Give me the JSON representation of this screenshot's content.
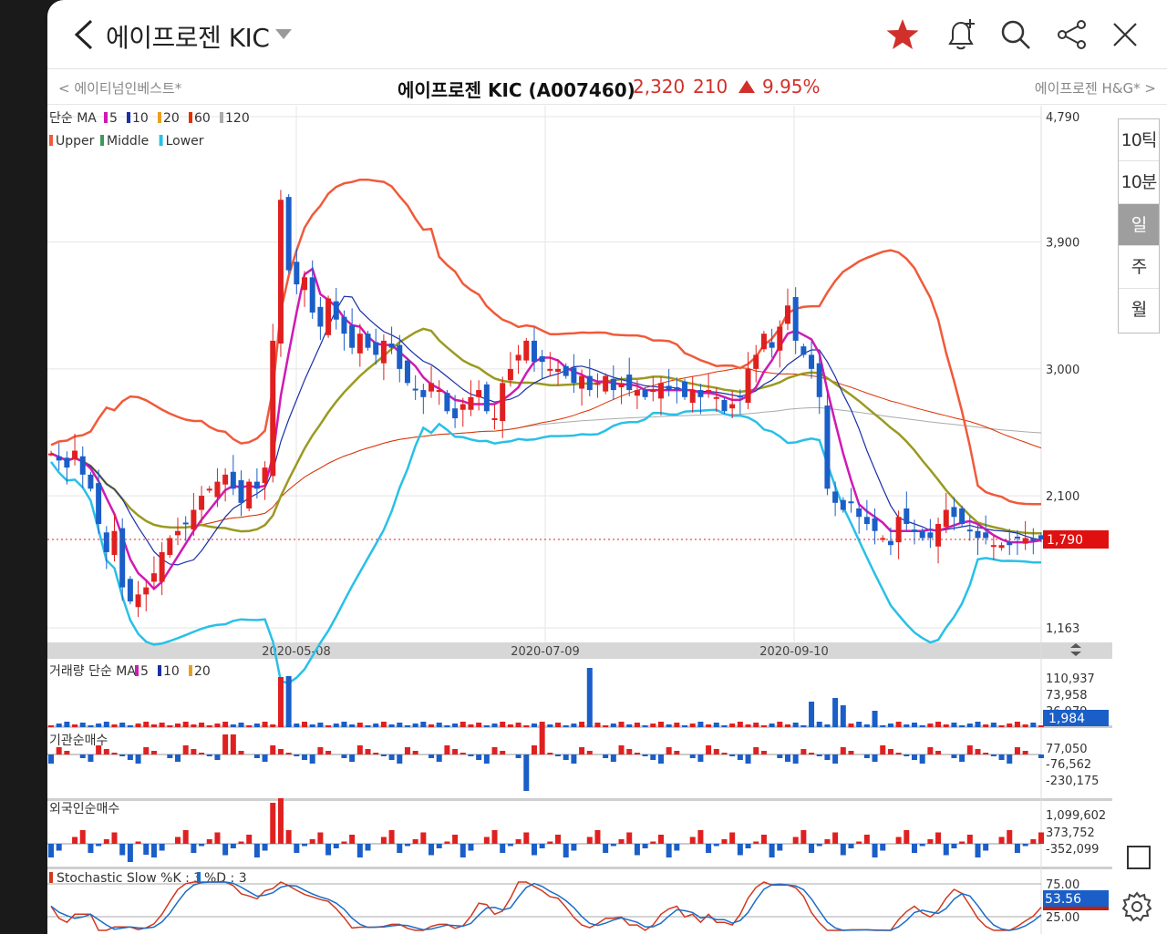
{
  "header": {
    "title": "에이프로젠 KIC",
    "back_icon": "chevron-left-icon",
    "favorite_icon": "star-icon",
    "favorite_color": "#d1302a"
  },
  "subheader": {
    "prev": "< 에이티넘인베스트*",
    "next": "에이프로젠 H&G* >",
    "name": "에이프로젠 KIC (A007460)",
    "price": "2,320",
    "change": "210",
    "percent": "9.95%"
  },
  "timeframes": [
    "10틱",
    "10분",
    "일",
    "주",
    "월"
  ],
  "timeframe_selected": "일",
  "price_panel": {
    "legend_ma": "단순 MA",
    "ma_periods": [
      "5",
      "10",
      "20",
      "60",
      "120"
    ],
    "ma_colors": [
      "#d019b4",
      "#1a2fa8",
      "#e8a020",
      "#e03000",
      "#aaaaaa"
    ],
    "legend_bb": [
      "Upper",
      "Middle",
      "Lower"
    ],
    "bb_colors": [
      "#f05a3a",
      "#3a9a5a",
      "#28c0e8"
    ],
    "y_ticks": [
      "4,790",
      "3,900",
      "3,000",
      "2,100",
      "1,163"
    ],
    "current": "1,790",
    "up_color": "#e02020",
    "down_color": "#1a5ec8"
  },
  "x_dates": [
    "2020-05-08",
    "2020-07-09",
    "2020-09-10"
  ],
  "volume_panel": {
    "legend": "거래량 단순 MA",
    "periods": [
      "5",
      "10",
      "20"
    ],
    "colors": [
      "#d019b4",
      "#1a2fa8",
      "#e8a020"
    ],
    "y_ticks": [
      "110,937",
      "73,958",
      "36,979"
    ],
    "current": "1,984"
  },
  "inst_panel": {
    "title": "기관순매수",
    "y_ticks": [
      "77,050",
      "-76,562",
      "-230,175"
    ]
  },
  "foreign_panel": {
    "title": "외국인순매수",
    "y_ticks": [
      "1,099,602",
      "373,752",
      "-352,099"
    ]
  },
  "stoch_panel": {
    "title": "Stochastic Slow %K : 3",
    "d_label": "%D : 3",
    "y_ticks": [
      "75.00",
      "25.00"
    ],
    "current": "53.56",
    "k_color": "#d13a20",
    "d_color": "#1a6ec8"
  },
  "chart_data": {
    "type": "candlestick",
    "closes": [
      2400,
      2350,
      2300,
      2420,
      2250,
      2150,
      1900,
      1700,
      1850,
      1450,
      1350,
      1400,
      1450,
      1550,
      1700,
      1800,
      1850,
      1900,
      2000,
      2100,
      2150,
      2200,
      2250,
      2150,
      2050,
      2200,
      2150,
      2300,
      3200,
      4200,
      3700,
      3600,
      3650,
      3400,
      3300,
      3500,
      3350,
      3250,
      3150,
      3250,
      3150,
      3100,
      3200,
      3150,
      3000,
      2900,
      2850,
      2800,
      2900,
      2850,
      2700,
      2650,
      2750,
      2800,
      2850,
      2700,
      2650,
      2900,
      3000,
      3100,
      3200,
      3050,
      3050,
      3000,
      3000,
      2950,
      2900,
      2950,
      2850,
      2900,
      2950,
      2850,
      2900,
      2850,
      2850,
      2800,
      2850,
      2900,
      2850,
      2850,
      2800,
      2850,
      2800,
      2850,
      2800,
      2700,
      2750,
      2800,
      3000,
      3100,
      3250,
      3150,
      3300,
      3450,
      3200,
      3100,
      3000,
      2800,
      2150,
      2050,
      2000,
      2050,
      1950,
      1900,
      1850,
      1800,
      1750,
      1950,
      1900,
      1850,
      1800,
      1800,
      1900,
      2000,
      1950,
      1900,
      1850,
      1800,
      1800,
      1750,
      1750,
      1750,
      1800,
      1800,
      1780,
      1790
    ]
  }
}
